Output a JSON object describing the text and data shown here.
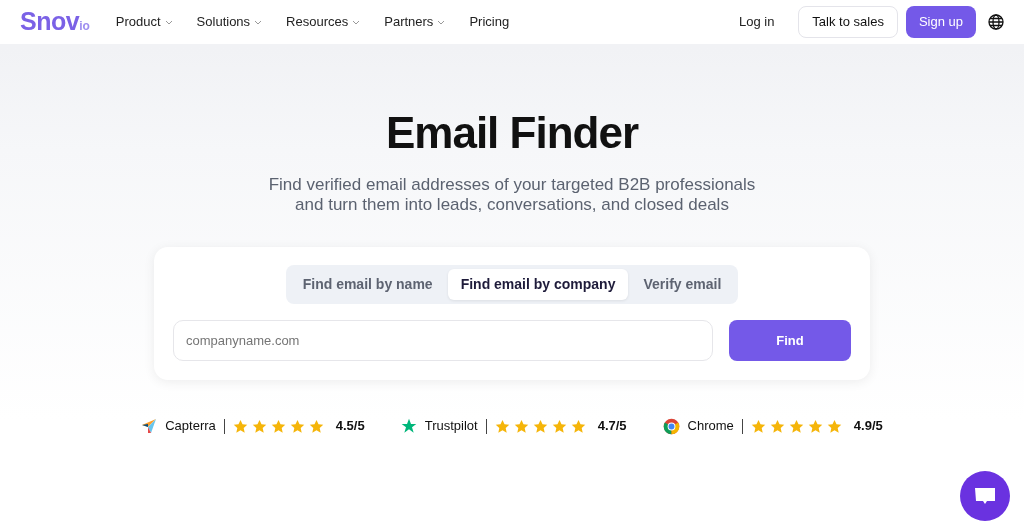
{
  "logo": {
    "name": "Snov",
    "suffix": "io"
  },
  "nav": [
    {
      "label": "Product",
      "dropdown": true
    },
    {
      "label": "Solutions",
      "dropdown": true
    },
    {
      "label": "Resources",
      "dropdown": true
    },
    {
      "label": "Partners",
      "dropdown": true
    },
    {
      "label": "Pricing",
      "dropdown": false
    }
  ],
  "header_actions": {
    "login": "Log in",
    "sales": "Talk to sales",
    "signup": "Sign up"
  },
  "hero": {
    "title": "Email Finder",
    "subtitle": [
      "Find verified email addresses of your targeted B2B professionals",
      "and turn them into leads, conversations, and closed deals"
    ]
  },
  "tabs": [
    {
      "label": "Find email by name",
      "selected": false
    },
    {
      "label": "Find email by company",
      "selected": true
    },
    {
      "label": "Verify email",
      "selected": false
    }
  ],
  "search": {
    "placeholder": "companyname.com",
    "button": "Find"
  },
  "ratings": [
    {
      "kind": "capterra",
      "name": "Capterra",
      "stars": 5,
      "score": "4.5/5"
    },
    {
      "kind": "trustpilot",
      "name": "Trustpilot",
      "stars": 5,
      "score": "4.7/5"
    },
    {
      "kind": "chrome",
      "name": "Chrome",
      "stars": 5,
      "score": "4.9/5"
    }
  ]
}
